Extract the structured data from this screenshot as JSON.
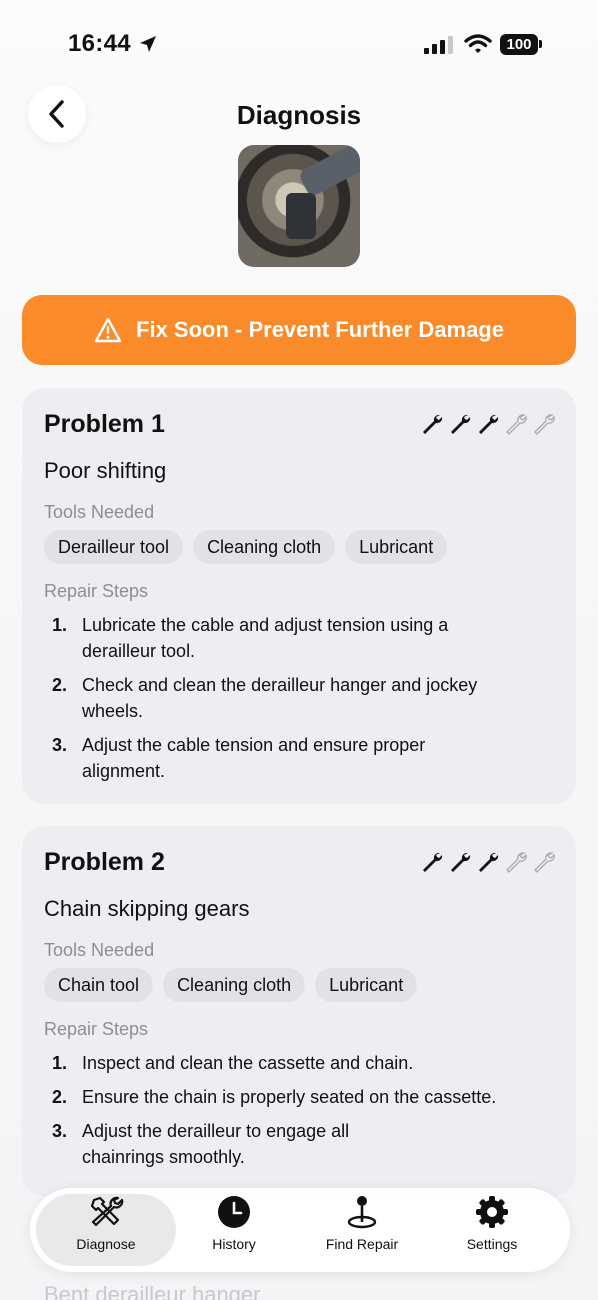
{
  "status_bar": {
    "time": "16:44",
    "battery": "100"
  },
  "header": {
    "title": "Diagnosis"
  },
  "severity": {
    "label": "Fix Soon - Prevent Further Damage",
    "color": "#fb8b2a"
  },
  "labels": {
    "tools_needed": "Tools Needed",
    "repair_steps": "Repair Steps"
  },
  "problems": [
    {
      "title": "Problem 1",
      "name": "Poor shifting",
      "difficulty": 3,
      "difficulty_max": 5,
      "tools": [
        "Derailleur tool",
        "Cleaning cloth",
        "Lubricant"
      ],
      "steps": [
        {
          "num": "1.",
          "text": "Lubricate the cable and adjust tension using a derailleur tool."
        },
        {
          "num": "2.",
          "text": "Check and clean the derailleur hanger and jockey wheels."
        },
        {
          "num": "3.",
          "text": "Adjust the cable tension and ensure proper alignment."
        }
      ]
    },
    {
      "title": "Problem 2",
      "name": "Chain skipping gears",
      "difficulty": 3,
      "difficulty_max": 5,
      "tools": [
        "Chain tool",
        "Cleaning cloth",
        "Lubricant"
      ],
      "steps": [
        {
          "num": "1.",
          "text": "Inspect and clean the cassette and chain."
        },
        {
          "num": "2.",
          "text": "Ensure the chain is properly seated on the cassette."
        },
        {
          "num": "3.",
          "text": "Adjust the derailleur to engage all chainrings smoothly."
        }
      ]
    }
  ],
  "peek": {
    "text": "Bent derailleur hanger"
  },
  "nav": [
    {
      "label": "Diagnose",
      "icon": "wrench-screwdriver-icon",
      "active": true
    },
    {
      "label": "History",
      "icon": "clock-icon",
      "active": false
    },
    {
      "label": "Find Repair",
      "icon": "map-pin-icon",
      "active": false
    },
    {
      "label": "Settings",
      "icon": "gear-icon",
      "active": false
    }
  ]
}
